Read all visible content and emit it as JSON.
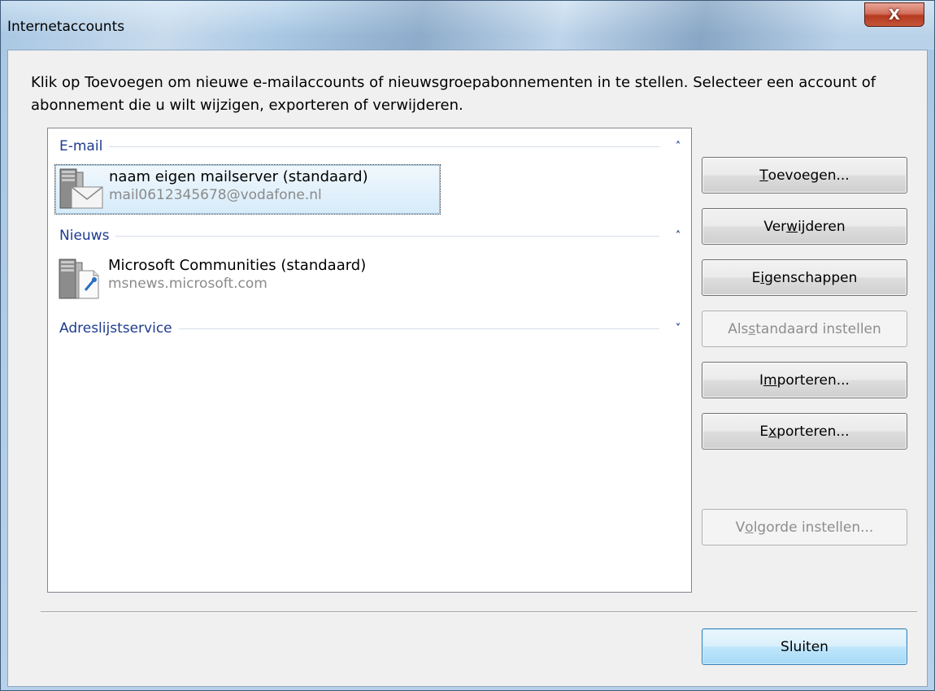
{
  "window": {
    "title": "Internetaccounts",
    "close_glyph": "X"
  },
  "description": "Klik op Toevoegen om nieuwe e-mailaccounts of nieuwsgroepabonnementen in te stellen. Selecteer een account of abonnement die u wilt wijzigen, exporteren of verwijderen.",
  "groups": [
    {
      "label": "E-mail",
      "chevron": "up",
      "accounts": [
        {
          "name": "naam eigen mailserver (standaard)",
          "detail": "mail0612345678@vodafone.nl",
          "icon": "mail-server-icon",
          "selected": true
        }
      ]
    },
    {
      "label": "Nieuws",
      "chevron": "up",
      "accounts": [
        {
          "name": "Microsoft Communities (standaard)",
          "detail": "msnews.microsoft.com",
          "icon": "news-server-icon",
          "selected": false
        }
      ]
    },
    {
      "label": "Adreslijstservice",
      "chevron": "down",
      "accounts": []
    }
  ],
  "buttons": {
    "add": {
      "pre": "",
      "key": "T",
      "post": "oevoegen...",
      "enabled": true
    },
    "remove": {
      "pre": "Ver",
      "key": "w",
      "post": "ijderen",
      "enabled": true
    },
    "properties": {
      "pre": "E",
      "key": "i",
      "post": "genschappen",
      "enabled": true
    },
    "set_default": {
      "pre": "Als ",
      "key": "s",
      "post": "tandaard instellen",
      "enabled": false
    },
    "import": {
      "pre": "I",
      "key": "m",
      "post": "porteren...",
      "enabled": true
    },
    "export": {
      "pre": "E",
      "key": "x",
      "post": "porteren...",
      "enabled": true
    },
    "set_order": {
      "pre": "V",
      "key": "o",
      "post": "lgorde instellen...",
      "enabled": false
    },
    "close": {
      "label": "Sluiten",
      "enabled": true
    }
  },
  "colors": {
    "group_header": "#1e3b8e",
    "secondary_text": "#8a8a8a",
    "selection": "#d6ebfa"
  }
}
